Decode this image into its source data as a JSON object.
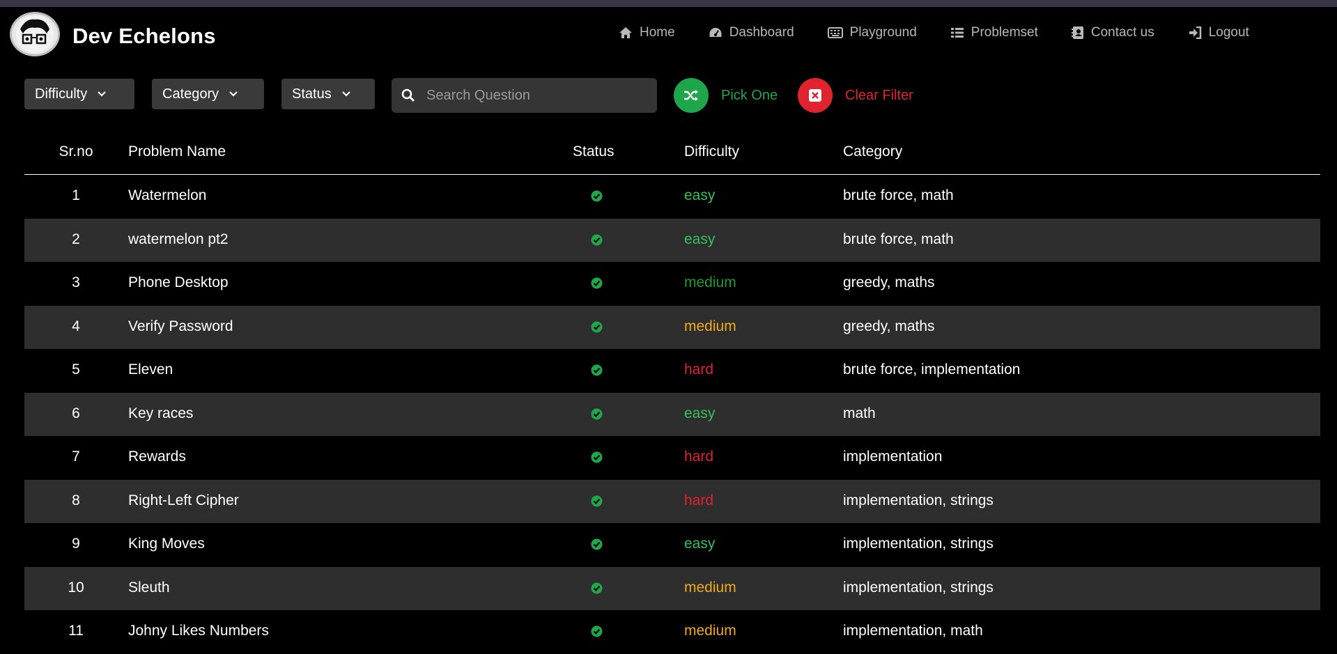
{
  "brand": {
    "title": "Dev Echelons"
  },
  "nav": [
    {
      "label": "Home",
      "icon": "home-icon"
    },
    {
      "label": "Dashboard",
      "icon": "dashboard-icon"
    },
    {
      "label": "Playground",
      "icon": "keyboard-icon"
    },
    {
      "label": "Problemset",
      "icon": "list-icon"
    },
    {
      "label": "Contact us",
      "icon": "contact-icon"
    },
    {
      "label": "Logout",
      "icon": "logout-icon"
    }
  ],
  "filters": {
    "difficulty": "Difficulty",
    "category": "Category",
    "status": "Status",
    "search_placeholder": "Search Question",
    "pick_one": "Pick One",
    "clear_filter": "Clear Filter"
  },
  "table": {
    "headers": {
      "sr": "Sr.no",
      "name": "Problem Name",
      "status": "Status",
      "difficulty": "Difficulty",
      "category": "Category"
    },
    "rows": [
      {
        "sr": "1",
        "name": "Watermelon",
        "difficulty": "easy",
        "category": "brute force, math"
      },
      {
        "sr": "2",
        "name": "watermelon pt2",
        "difficulty": "easy",
        "category": "brute force, math"
      },
      {
        "sr": "3",
        "name": "Phone Desktop",
        "difficulty": "medium",
        "category": "greedy, maths"
      },
      {
        "sr": "4",
        "name": "Verify Password",
        "difficulty": "medium",
        "category": "greedy, maths"
      },
      {
        "sr": "5",
        "name": "Eleven",
        "difficulty": "hard",
        "category": "brute force, implementation"
      },
      {
        "sr": "6",
        "name": "Key races",
        "difficulty": "easy",
        "category": "math"
      },
      {
        "sr": "7",
        "name": "Rewards",
        "difficulty": "hard",
        "category": "implementation"
      },
      {
        "sr": "8",
        "name": "Right-Left Cipher",
        "difficulty": "hard",
        "category": "implementation, strings"
      },
      {
        "sr": "9",
        "name": "King Moves",
        "difficulty": "easy",
        "category": "implementation, strings"
      },
      {
        "sr": "10",
        "name": "Sleuth",
        "difficulty": "medium",
        "category": "implementation, strings"
      },
      {
        "sr": "11",
        "name": "Johny Likes Numbers",
        "difficulty": "medium",
        "category": "implementation, math"
      }
    ]
  },
  "colors": {
    "easy": "#34c15a",
    "medium": "#f0a91e",
    "hard": "#e0242f",
    "status_ok": "#1fa64a",
    "pick_one": "#1fa64a",
    "clear_filter": "#e0242f"
  }
}
